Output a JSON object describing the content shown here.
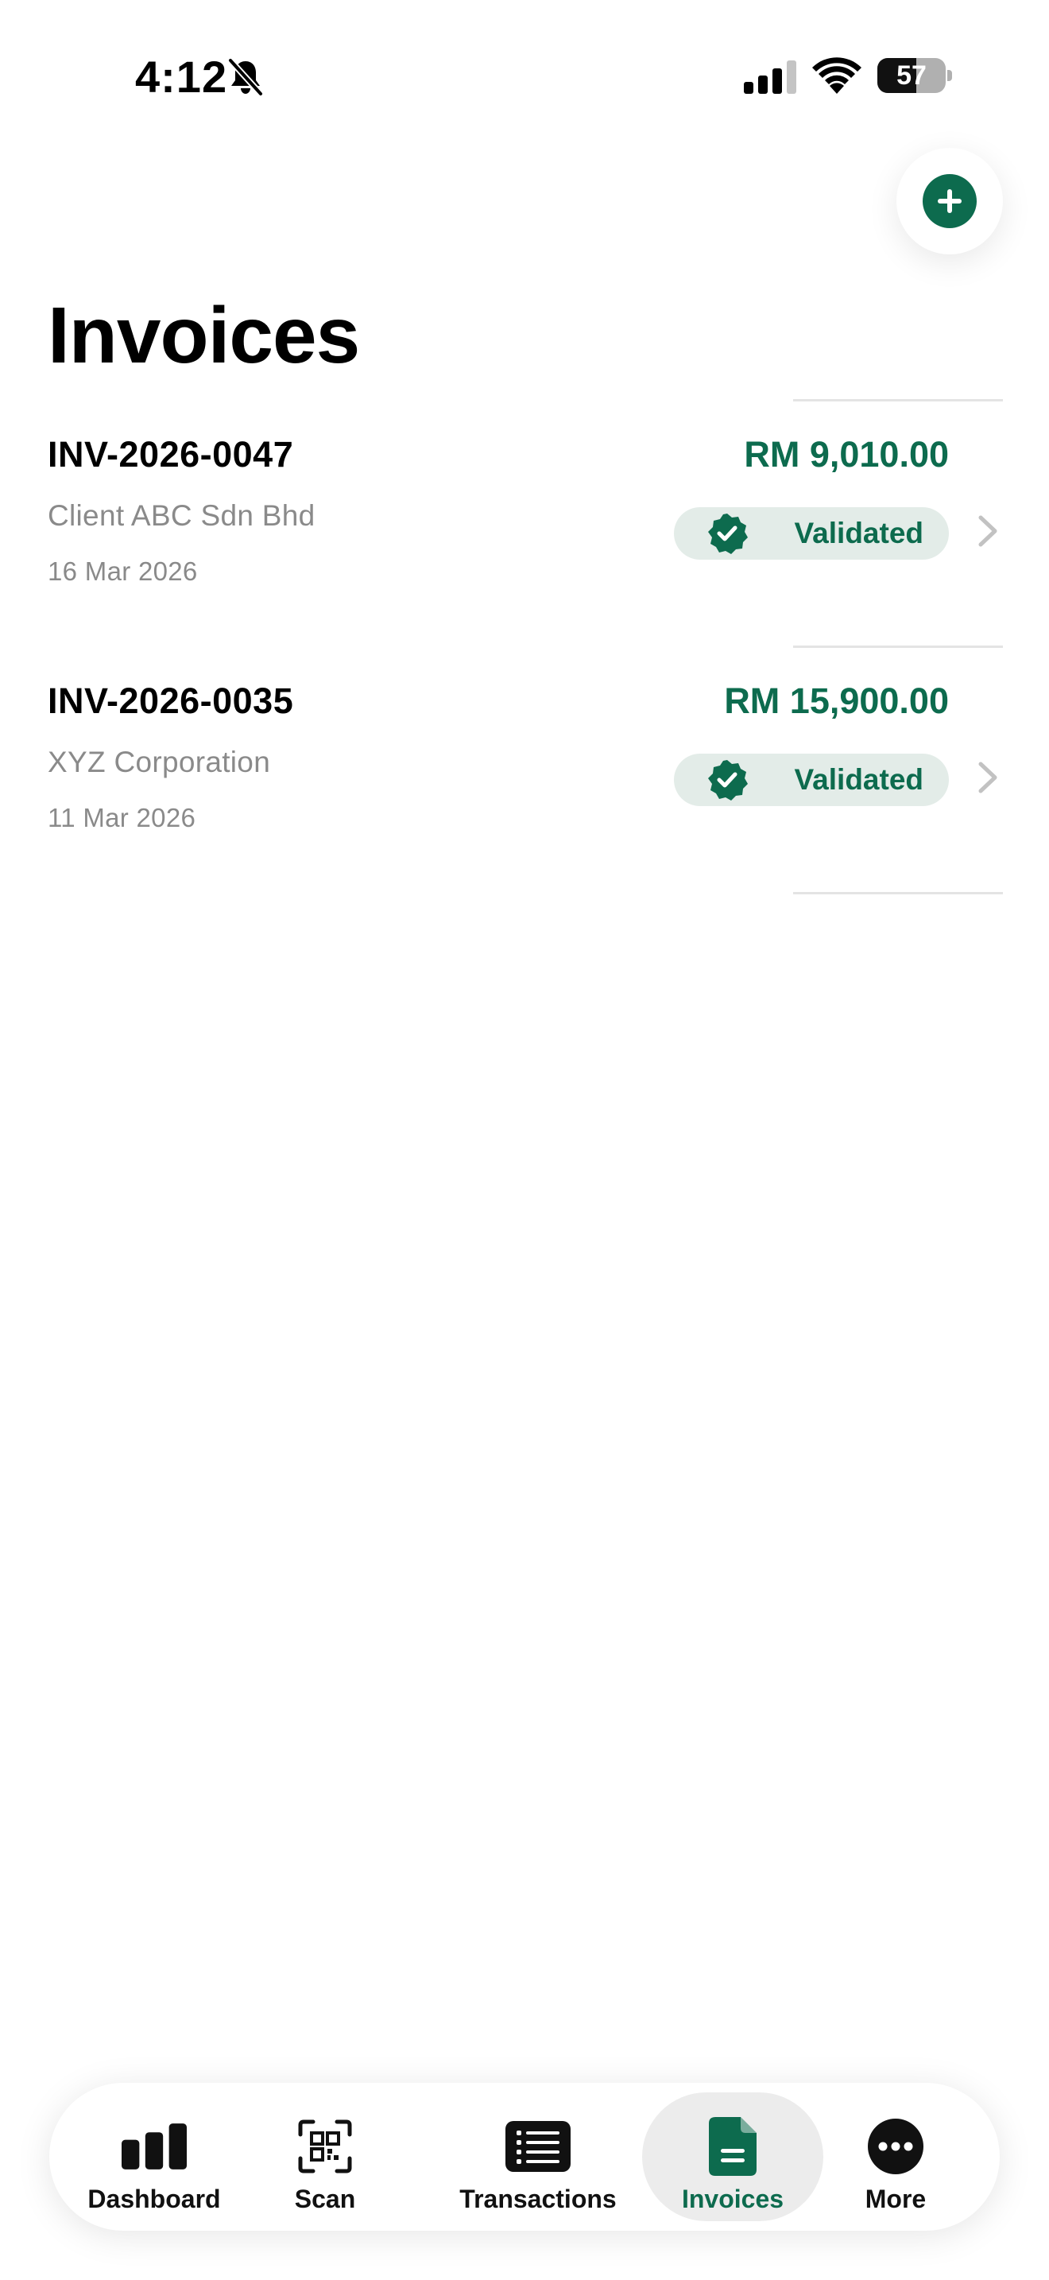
{
  "theme": {
    "brand_green": "#0d6b4e",
    "badge_bg": "#e3ece8",
    "muted_text": "#8a8a8a"
  },
  "status_bar": {
    "time": "4:12",
    "battery_level": "57",
    "battery_percent": 57,
    "icons": [
      "bell-slash-icon",
      "cellular-signal-icon",
      "wifi-icon",
      "battery-icon"
    ]
  },
  "header": {
    "title": "Invoices",
    "add_button_icon": "plus-icon"
  },
  "invoices": [
    {
      "number": "INV-2026-0047",
      "client": "Client ABC Sdn Bhd",
      "date": "16 Mar 2026",
      "amount": "RM 9,010.00",
      "status": "Validated"
    },
    {
      "number": "INV-2026-0035",
      "client": "XYZ Corporation",
      "date": "11 Mar 2026",
      "amount": "RM 15,900.00",
      "status": "Validated"
    }
  ],
  "tab_bar": {
    "active": "Invoices",
    "tabs": [
      {
        "label": "Dashboard",
        "icon": "bar-chart-icon"
      },
      {
        "label": "Scan",
        "icon": "qr-scan-icon"
      },
      {
        "label": "Transactions",
        "icon": "list-icon"
      },
      {
        "label": "Invoices",
        "icon": "document-icon"
      },
      {
        "label": "More",
        "icon": "ellipsis-circle-icon"
      }
    ]
  }
}
